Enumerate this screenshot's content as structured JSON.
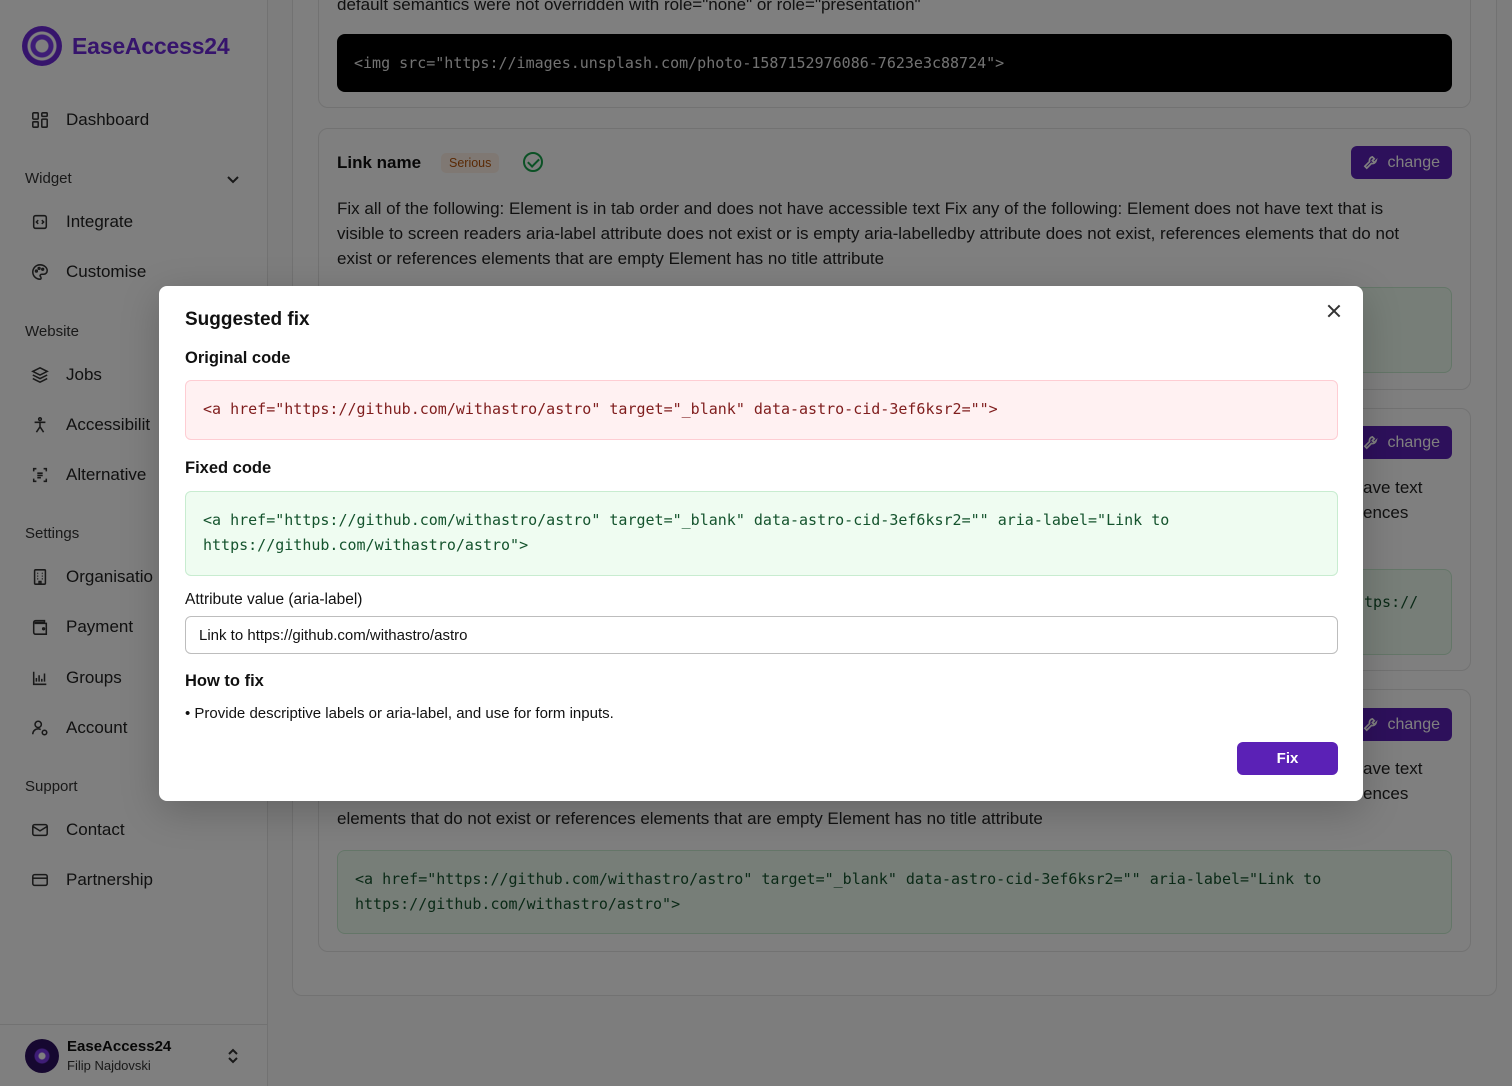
{
  "brand": {
    "name": "EaseAccess24",
    "accent": "#6d28d9"
  },
  "sidebar": {
    "dashboard": "Dashboard",
    "widget_section": "Widget",
    "integrate": "Integrate",
    "customise": "Customise",
    "website_section": "Website",
    "jobs": "Jobs",
    "accessibility": "Accessibilit",
    "alternative": "Alternative",
    "settings_section": "Settings",
    "organisation": "Organisatio",
    "payment": "Payment",
    "groups": "Groups",
    "account": "Account",
    "support_section": "Support",
    "contact": "Contact",
    "partnership": "Partnership",
    "profile": {
      "org": "EaseAccess24",
      "user": "Filip Najdovski"
    }
  },
  "content": {
    "top_text": "default semantics were not overridden with role=\"none\" or role=\"presentation\"",
    "top_code": "<img src=\"https://images.unsplash.com/photo-1587152976086-7623e3c88724\">",
    "card1": {
      "title": "Link name",
      "severity": "Serious",
      "change_label": "change",
      "description": "Fix all of the following: Element is in tab order and does not have accessible text Fix any of the following: Element does not have text that is visible to screen readers aria-label attribute does not exist or is empty aria-labelledby attribute does not exist, references elements that do not exist or references elements that are empty Element has no title attribute"
    },
    "card2": {
      "change_label": "change",
      "frag1": "ave text",
      "frag2": "ences",
      "code_frag": "tps://"
    },
    "card3": {
      "change_label": "change",
      "frag1": "ave text",
      "frag2": "ences",
      "desc_tail": "elements that do not exist or references elements that are empty Element has no title attribute",
      "code": "<a href=\"https://github.com/withastro/astro\" target=\"_blank\" data-astro-cid-3ef6ksr2=\"\" aria-label=\"Link to https://github.com/withastro/astro\">"
    }
  },
  "modal": {
    "title": "Suggested fix",
    "original_label": "Original code",
    "original_code": "<a href=\"https://github.com/withastro/astro\" target=\"_blank\" data-astro-cid-3ef6ksr2=\"\">",
    "fixed_label": "Fixed code",
    "fixed_code": "<a href=\"https://github.com/withastro/astro\" target=\"_blank\" data-astro-cid-3ef6ksr2=\"\" aria-label=\"Link to https://github.com/withastro/astro\">",
    "attr_label": "Attribute value (aria-label)",
    "attr_value": "Link to https://github.com/withastro/astro",
    "howto_label": "How to fix",
    "howto_item": "• Provide descriptive labels or aria-label, and use for form inputs.",
    "fix_label": "Fix"
  }
}
